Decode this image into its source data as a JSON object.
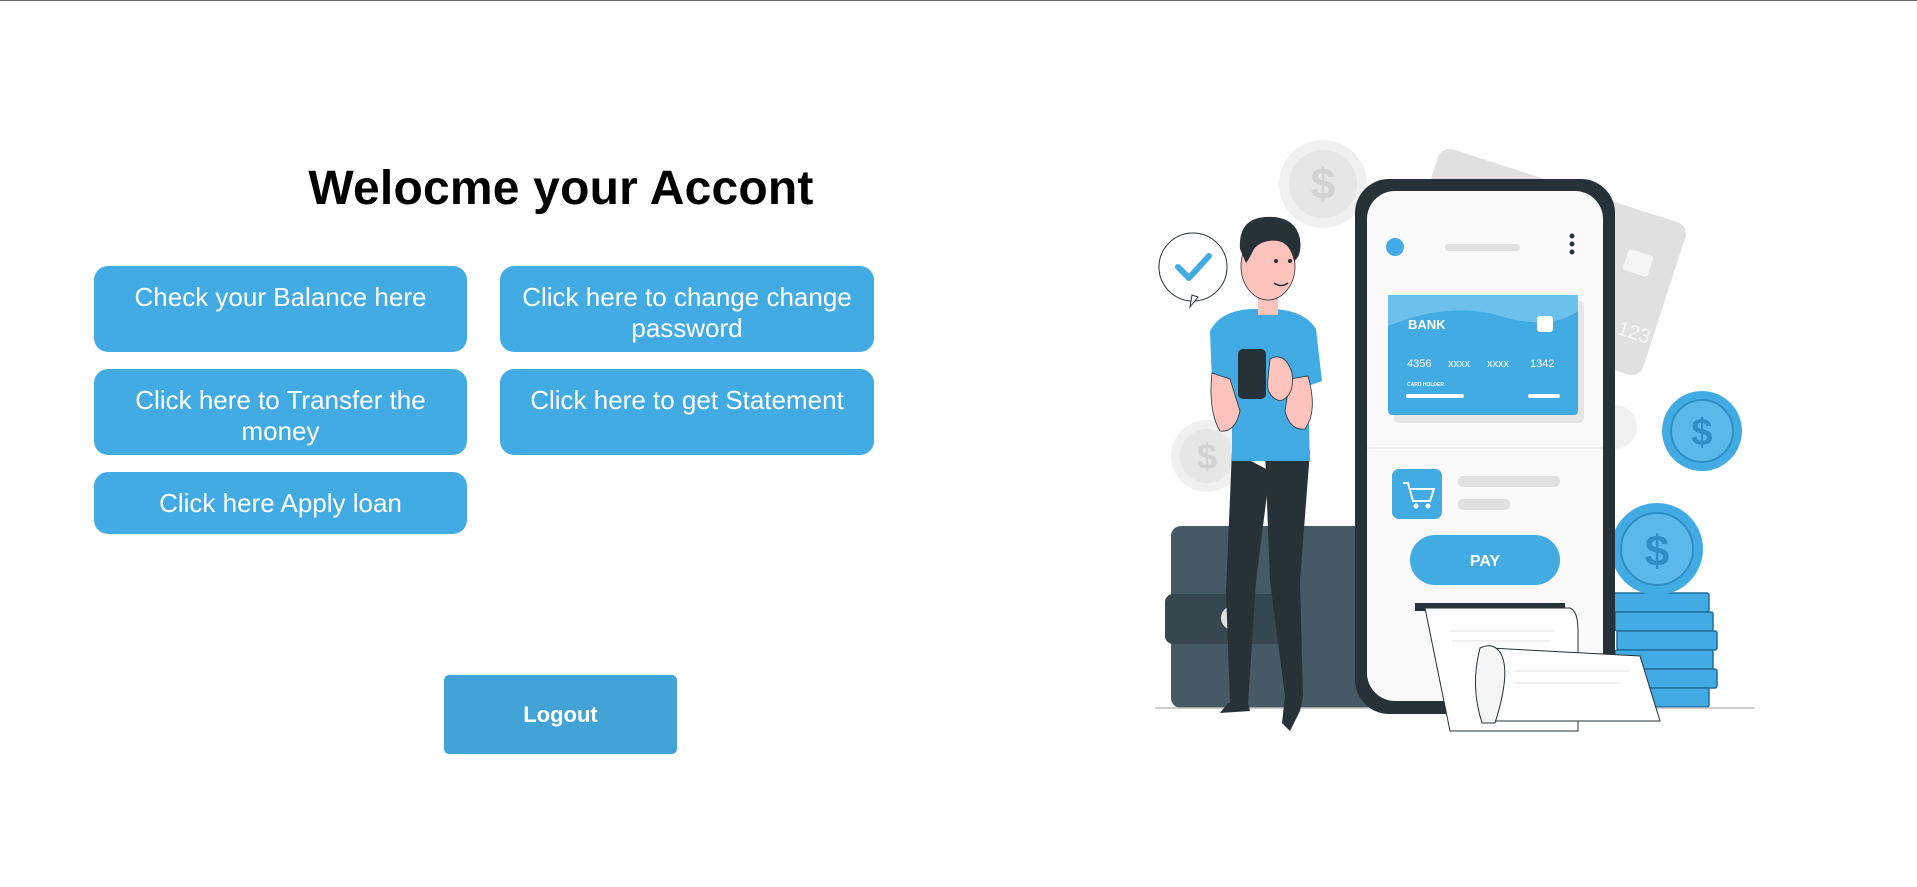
{
  "page": {
    "title": "Welocme your Accont"
  },
  "actions": {
    "balance": "Check your Balance here",
    "change_password": "Click here to change change password",
    "transfer": "Click here to Transfer the money",
    "statement": "Click here to get Statement",
    "apply_loan": "Click here Apply loan"
  },
  "logout_label": "Logout",
  "illustration": {
    "card_brand": "BANK",
    "card_numbers": [
      "4356",
      "xxxx",
      "xxxx",
      "1342"
    ],
    "card_holder": "CARD HOLDER",
    "back_card_number": "789 123",
    "pay_label": "PAY",
    "coin_symbol": "$",
    "colors": {
      "accent": "#42abe3",
      "dark": "#263238",
      "wallet": "#455a64",
      "coin_light": "#ebebeb"
    }
  }
}
